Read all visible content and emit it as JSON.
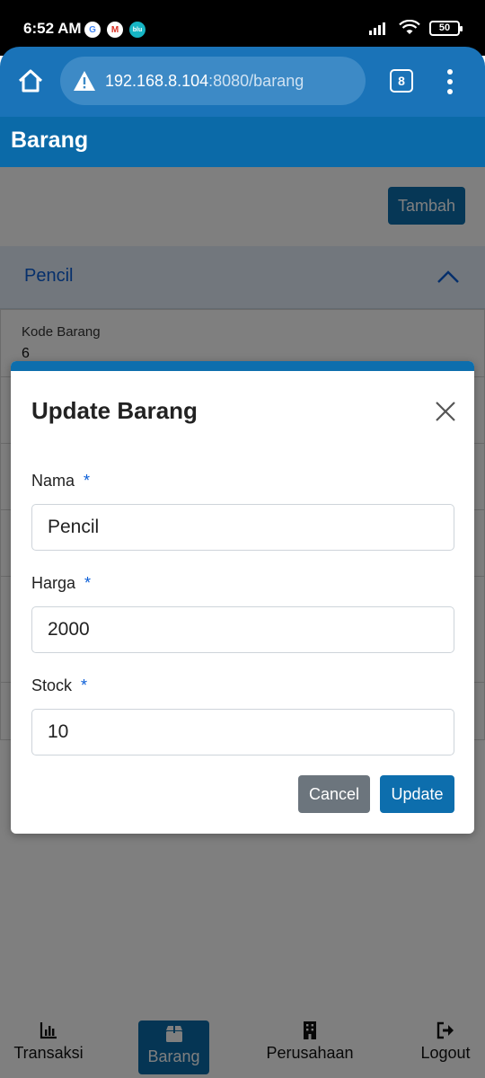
{
  "status_bar": {
    "time": "6:52 AM",
    "notifications": [
      "G",
      "M",
      "blu"
    ],
    "battery": "50"
  },
  "browser": {
    "url_host": "192.168.8.104",
    "url_path": ":8080/barang",
    "tab_count": "8",
    "icons": [
      "home-icon",
      "warning-icon",
      "more-vert-icon"
    ]
  },
  "app": {
    "page_title": "Barang",
    "add_button": "Tambah"
  },
  "accordion": {
    "title": "Pencil",
    "kode_label": "Kode Barang",
    "kode_value": "6"
  },
  "modal": {
    "title": "Update Barang",
    "fields": [
      {
        "label": "Nama",
        "required": "*",
        "value": "Pencil"
      },
      {
        "label": "Harga",
        "required": "*",
        "value": "2000"
      },
      {
        "label": "Stock",
        "required": "*",
        "value": "10"
      }
    ],
    "cancel_label": "Cancel",
    "update_label": "Update"
  },
  "bottom_nav": [
    {
      "label": "Transaksi",
      "icon": "chart-icon"
    },
    {
      "label": "Barang",
      "icon": "box-icon",
      "active": true
    },
    {
      "label": "Perusahaan",
      "icon": "building-icon"
    },
    {
      "label": "Logout",
      "icon": "logout-icon"
    }
  ],
  "colors": {
    "primary": "#0d6ead",
    "accent_blue": "#1a73b8",
    "cancel_gray": "#6c757d"
  }
}
